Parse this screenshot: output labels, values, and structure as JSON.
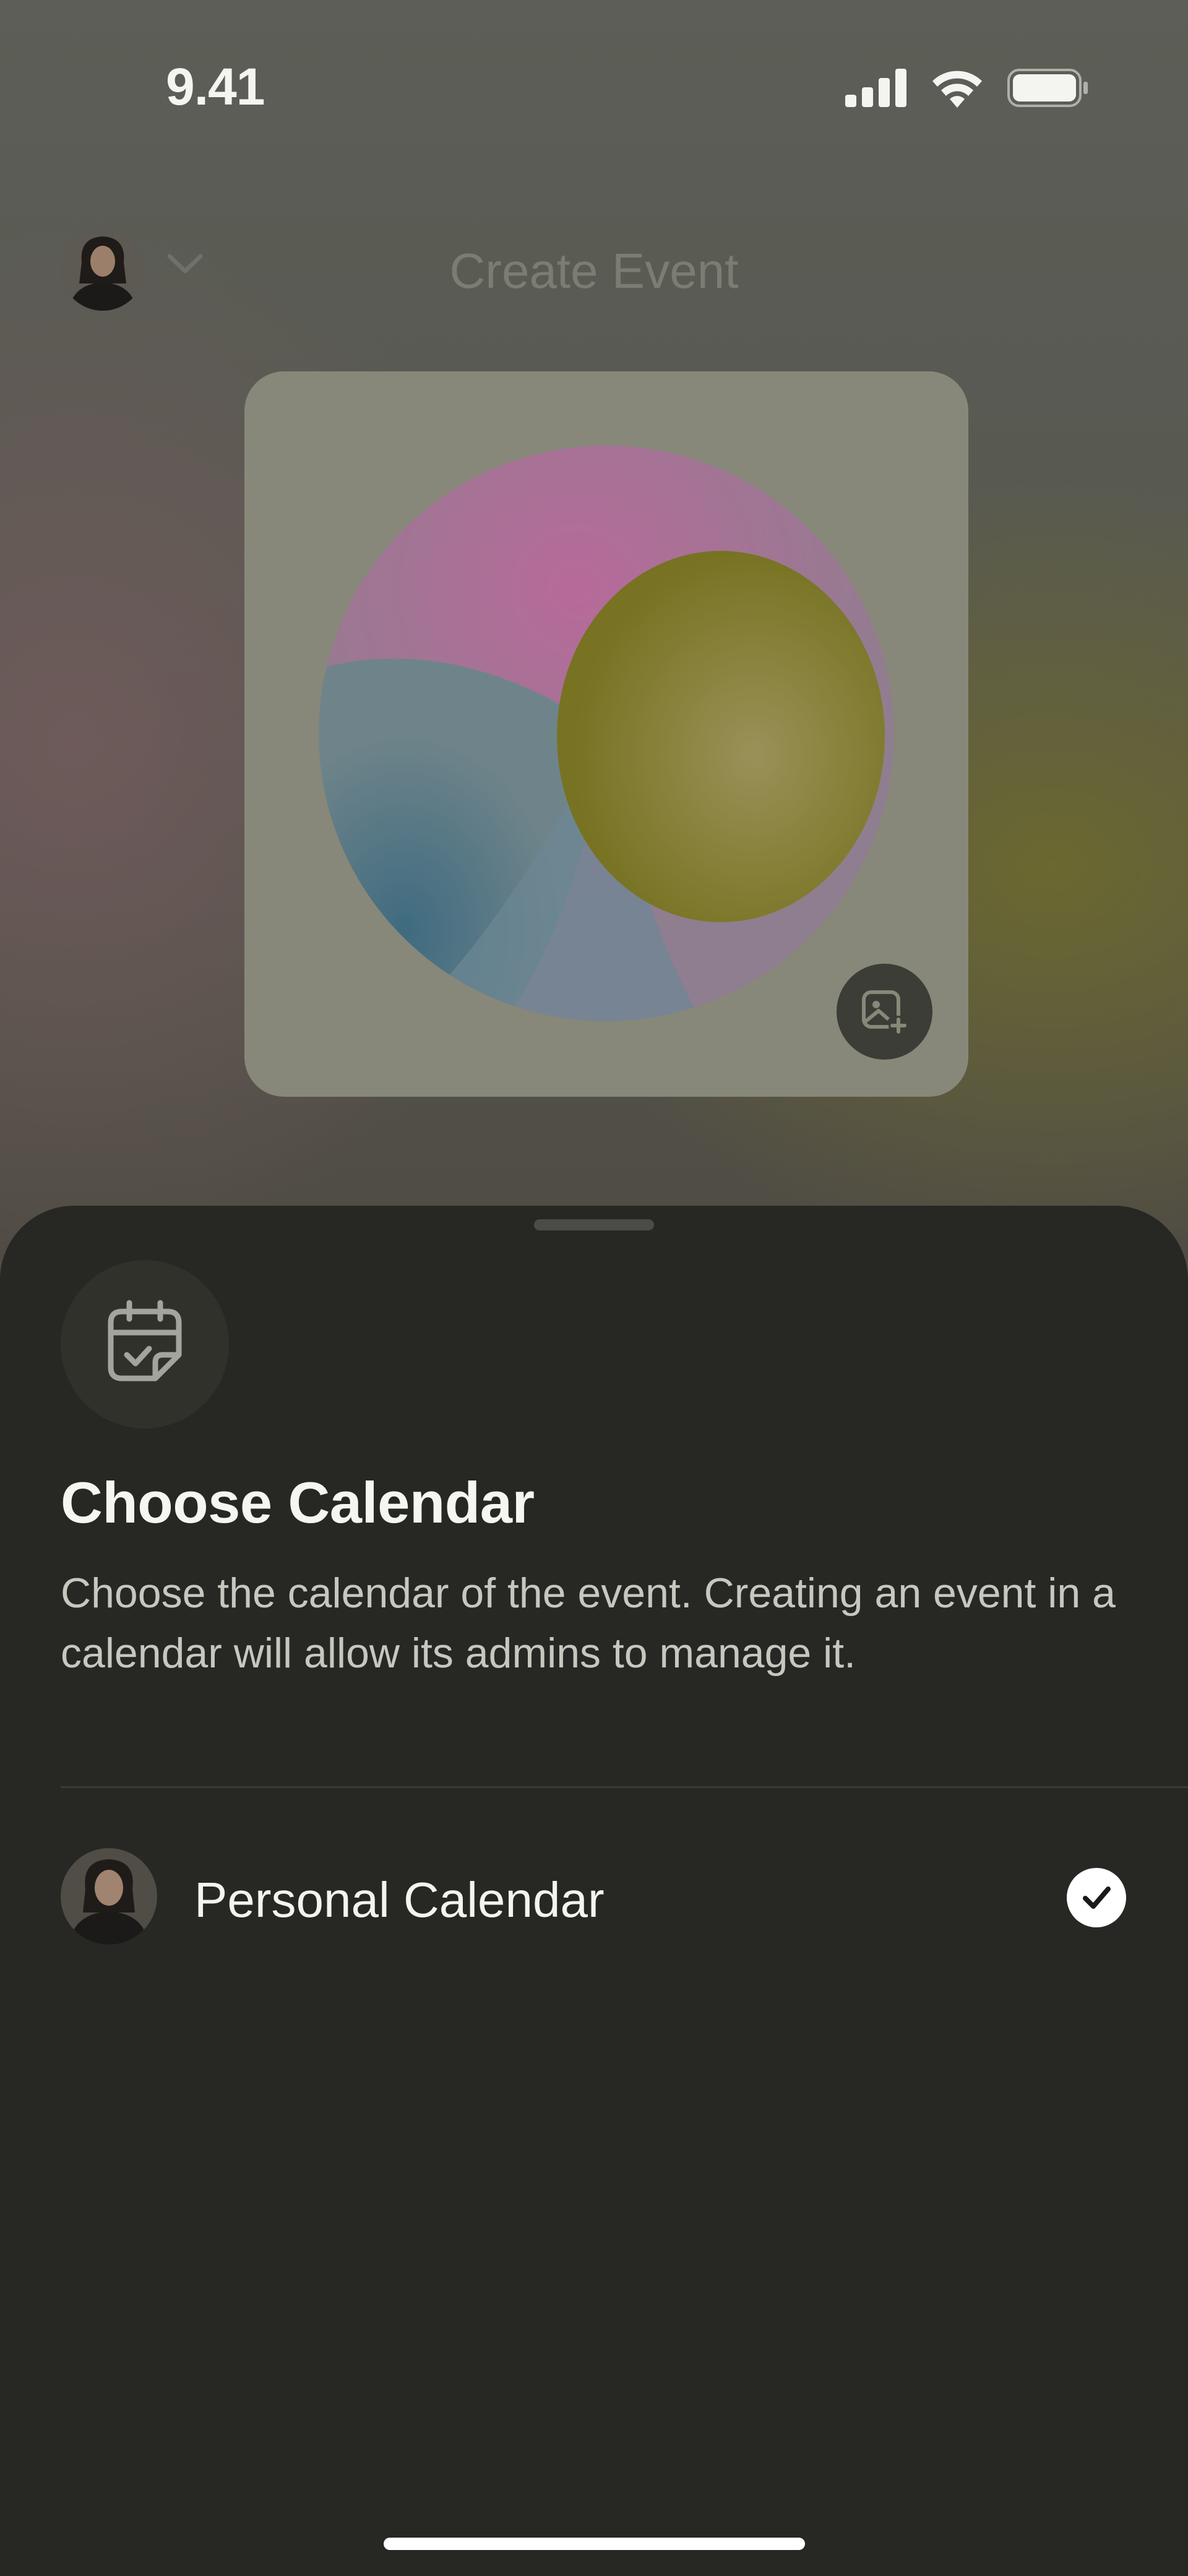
{
  "status_bar": {
    "time": "9.41",
    "icons": [
      "cellular-signal-icon",
      "wifi-icon",
      "battery-icon"
    ]
  },
  "background_page": {
    "title": "Create Event",
    "creator_avatar": "avatar",
    "creator_chevron_icon": "chevron-down-icon",
    "cover_change_icon": "image-plus-icon"
  },
  "sheet": {
    "icon": "calendar-check-icon",
    "title": "Choose Calendar",
    "description": "Choose the calendar of the event. Creating an event in a calendar will allow its admins to manage it.",
    "calendars": [
      {
        "name": "Personal Calendar",
        "selected": true
      }
    ]
  },
  "colors": {
    "sheet_bg": "#272723",
    "text_primary": "#f5f5f2",
    "text_secondary": "#c7c7c0",
    "check_bg": "#ffffff"
  }
}
